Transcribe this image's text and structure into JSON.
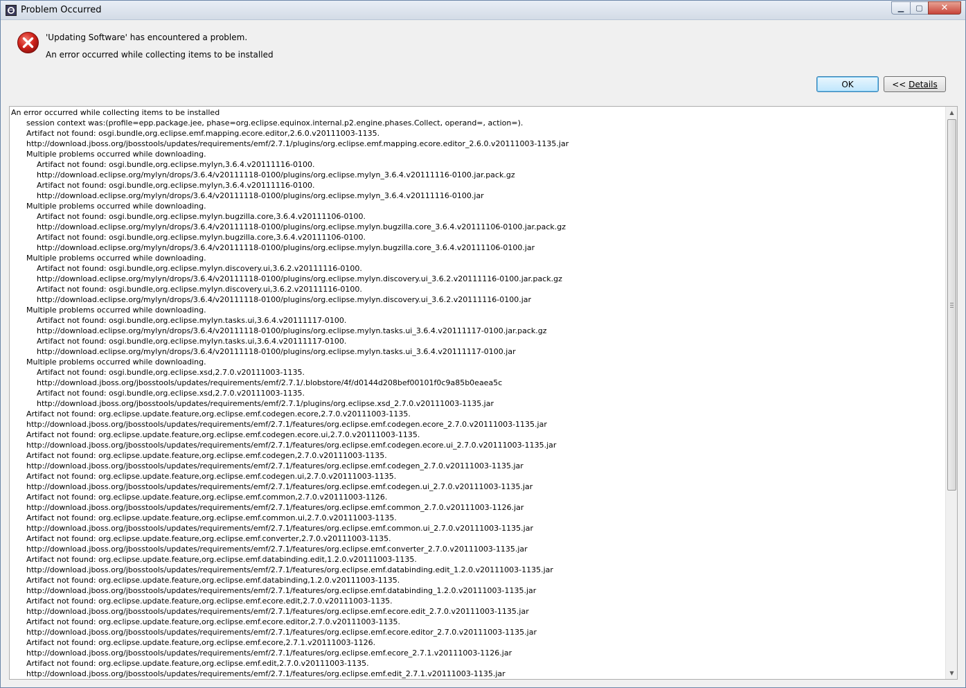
{
  "window": {
    "title": "Problem Occurred",
    "controls": {
      "minimize_icon": "minimize-icon",
      "maximize_icon": "maximize-icon",
      "close_icon": "close-icon"
    }
  },
  "message": {
    "icon": "error-icon",
    "line1": "'Updating Software' has encountered a problem.",
    "line2": "An error occurred while collecting items to be installed"
  },
  "buttons": {
    "ok_label": "OK",
    "details_prefix": "<< ",
    "details_label": "Details"
  },
  "details": {
    "lines": [
      "An error occurred while collecting items to be installed",
      "session context was:(profile=epp.package.jee, phase=org.eclipse.equinox.internal.p2.engine.phases.Collect, operand=, action=).",
      "Artifact not found: osgi.bundle,org.eclipse.emf.mapping.ecore.editor,2.6.0.v20111003-1135.",
      "http://download.jboss.org/jbosstools/updates/requirements/emf/2.7.1/plugins/org.eclipse.emf.mapping.ecore.editor_2.6.0.v20111003-1135.jar",
      "Multiple problems occurred while downloading.",
      "Artifact not found: osgi.bundle,org.eclipse.mylyn,3.6.4.v20111116-0100.",
      "http://download.eclipse.org/mylyn/drops/3.6.4/v20111118-0100/plugins/org.eclipse.mylyn_3.6.4.v20111116-0100.jar.pack.gz",
      "Artifact not found: osgi.bundle,org.eclipse.mylyn,3.6.4.v20111116-0100.",
      "http://download.eclipse.org/mylyn/drops/3.6.4/v20111118-0100/plugins/org.eclipse.mylyn_3.6.4.v20111116-0100.jar",
      "Multiple problems occurred while downloading.",
      "Artifact not found: osgi.bundle,org.eclipse.mylyn.bugzilla.core,3.6.4.v20111106-0100.",
      "http://download.eclipse.org/mylyn/drops/3.6.4/v20111118-0100/plugins/org.eclipse.mylyn.bugzilla.core_3.6.4.v20111106-0100.jar.pack.gz",
      "Artifact not found: osgi.bundle,org.eclipse.mylyn.bugzilla.core,3.6.4.v20111106-0100.",
      "http://download.eclipse.org/mylyn/drops/3.6.4/v20111118-0100/plugins/org.eclipse.mylyn.bugzilla.core_3.6.4.v20111106-0100.jar",
      "Multiple problems occurred while downloading.",
      "Artifact not found: osgi.bundle,org.eclipse.mylyn.discovery.ui,3.6.2.v20111116-0100.",
      "http://download.eclipse.org/mylyn/drops/3.6.4/v20111118-0100/plugins/org.eclipse.mylyn.discovery.ui_3.6.2.v20111116-0100.jar.pack.gz",
      "Artifact not found: osgi.bundle,org.eclipse.mylyn.discovery.ui,3.6.2.v20111116-0100.",
      "http://download.eclipse.org/mylyn/drops/3.6.4/v20111118-0100/plugins/org.eclipse.mylyn.discovery.ui_3.6.2.v20111116-0100.jar",
      "Multiple problems occurred while downloading.",
      "Artifact not found: osgi.bundle,org.eclipse.mylyn.tasks.ui,3.6.4.v20111117-0100.",
      "http://download.eclipse.org/mylyn/drops/3.6.4/v20111118-0100/plugins/org.eclipse.mylyn.tasks.ui_3.6.4.v20111117-0100.jar.pack.gz",
      "Artifact not found: osgi.bundle,org.eclipse.mylyn.tasks.ui,3.6.4.v20111117-0100.",
      "http://download.eclipse.org/mylyn/drops/3.6.4/v20111118-0100/plugins/org.eclipse.mylyn.tasks.ui_3.6.4.v20111117-0100.jar",
      "Multiple problems occurred while downloading.",
      "Artifact not found: osgi.bundle,org.eclipse.xsd,2.7.0.v20111003-1135.",
      "http://download.jboss.org/jbosstools/updates/requirements/emf/2.7.1/.blobstore/4f/d0144d208bef00101f0c9a85b0eaea5c",
      "Artifact not found: osgi.bundle,org.eclipse.xsd,2.7.0.v20111003-1135.",
      "http://download.jboss.org/jbosstools/updates/requirements/emf/2.7.1/plugins/org.eclipse.xsd_2.7.0.v20111003-1135.jar",
      "Artifact not found: org.eclipse.update.feature,org.eclipse.emf.codegen.ecore,2.7.0.v20111003-1135.",
      "http://download.jboss.org/jbosstools/updates/requirements/emf/2.7.1/features/org.eclipse.emf.codegen.ecore_2.7.0.v20111003-1135.jar",
      "Artifact not found: org.eclipse.update.feature,org.eclipse.emf.codegen.ecore.ui,2.7.0.v20111003-1135.",
      "http://download.jboss.org/jbosstools/updates/requirements/emf/2.7.1/features/org.eclipse.emf.codegen.ecore.ui_2.7.0.v20111003-1135.jar",
      "Artifact not found: org.eclipse.update.feature,org.eclipse.emf.codegen,2.7.0.v20111003-1135.",
      "http://download.jboss.org/jbosstools/updates/requirements/emf/2.7.1/features/org.eclipse.emf.codegen_2.7.0.v20111003-1135.jar",
      "Artifact not found: org.eclipse.update.feature,org.eclipse.emf.codegen.ui,2.7.0.v20111003-1135.",
      "http://download.jboss.org/jbosstools/updates/requirements/emf/2.7.1/features/org.eclipse.emf.codegen.ui_2.7.0.v20111003-1135.jar",
      "Artifact not found: org.eclipse.update.feature,org.eclipse.emf.common,2.7.0.v20111003-1126.",
      "http://download.jboss.org/jbosstools/updates/requirements/emf/2.7.1/features/org.eclipse.emf.common_2.7.0.v20111003-1126.jar",
      "Artifact not found: org.eclipse.update.feature,org.eclipse.emf.common.ui,2.7.0.v20111003-1135.",
      "http://download.jboss.org/jbosstools/updates/requirements/emf/2.7.1/features/org.eclipse.emf.common.ui_2.7.0.v20111003-1135.jar",
      "Artifact not found: org.eclipse.update.feature,org.eclipse.emf.converter,2.7.0.v20111003-1135.",
      "http://download.jboss.org/jbosstools/updates/requirements/emf/2.7.1/features/org.eclipse.emf.converter_2.7.0.v20111003-1135.jar",
      "Artifact not found: org.eclipse.update.feature,org.eclipse.emf.databinding.edit,1.2.0.v20111003-1135.",
      "http://download.jboss.org/jbosstools/updates/requirements/emf/2.7.1/features/org.eclipse.emf.databinding.edit_1.2.0.v20111003-1135.jar",
      "Artifact not found: org.eclipse.update.feature,org.eclipse.emf.databinding,1.2.0.v20111003-1135.",
      "http://download.jboss.org/jbosstools/updates/requirements/emf/2.7.1/features/org.eclipse.emf.databinding_1.2.0.v20111003-1135.jar",
      "Artifact not found: org.eclipse.update.feature,org.eclipse.emf.ecore.edit,2.7.0.v20111003-1135.",
      "http://download.jboss.org/jbosstools/updates/requirements/emf/2.7.1/features/org.eclipse.emf.ecore.edit_2.7.0.v20111003-1135.jar",
      "Artifact not found: org.eclipse.update.feature,org.eclipse.emf.ecore.editor,2.7.0.v20111003-1135.",
      "http://download.jboss.org/jbosstools/updates/requirements/emf/2.7.1/features/org.eclipse.emf.ecore.editor_2.7.0.v20111003-1135.jar",
      "Artifact not found: org.eclipse.update.feature,org.eclipse.emf.ecore,2.7.1.v20111003-1126.",
      "http://download.jboss.org/jbosstools/updates/requirements/emf/2.7.1/features/org.eclipse.emf.ecore_2.7.1.v20111003-1126.jar",
      "Artifact not found: org.eclipse.update.feature,org.eclipse.emf.edit,2.7.0.v20111003-1135.",
      "http://download.jboss.org/jbosstools/updates/requirements/emf/2.7.1/features/org.eclipse.emf.edit_2.7.1.v20111003-1135.jar"
    ]
  },
  "scrollbar": {
    "up_icon": "scroll-up-arrow-icon",
    "down_icon": "scroll-down-arrow-icon"
  }
}
